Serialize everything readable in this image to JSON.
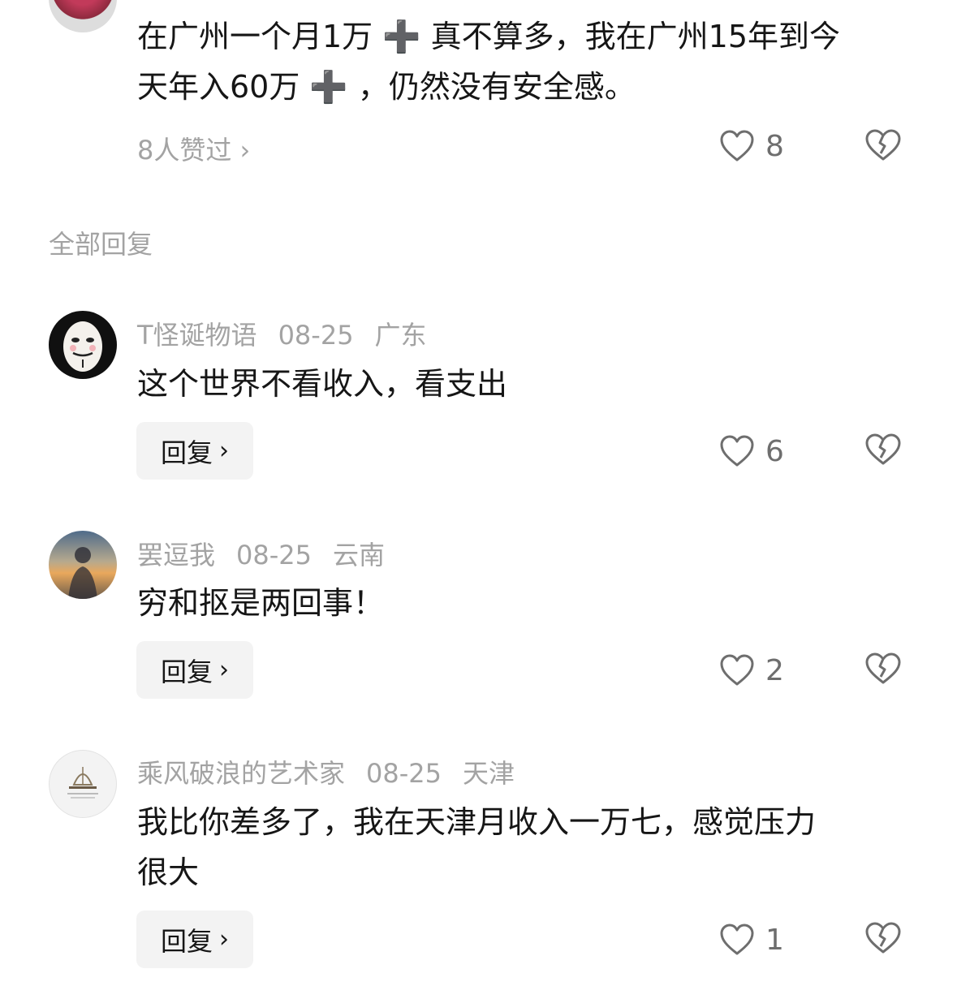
{
  "top_comment": {
    "text_line1": "在广州一个月1万 ➕ 真不算多，我在广州15年到今",
    "text_line2": "天年入60万 ➕ ，仍然没有安全感。",
    "liked_by": "8人赞过 ›",
    "likes": "8"
  },
  "section_title": "全部回复",
  "replies": [
    {
      "user": "T怪诞物语",
      "date": "08-25",
      "region": "广东",
      "text": "这个世界不看收入，看支出",
      "reply_label": "回复",
      "likes": "6"
    },
    {
      "user": "罢逗我",
      "date": "08-25",
      "region": "云南",
      "text": "穷和抠是两回事！",
      "reply_label": "回复",
      "likes": "2"
    },
    {
      "user": "乘风破浪的艺术家",
      "date": "08-25",
      "region": "天津",
      "text_line1": "我比你差多了，我在天津月收入一万七，感觉压力",
      "text_line2": "很大",
      "reply_label": "回复",
      "likes": "1"
    }
  ],
  "icons": {
    "like": "heart-outline-icon",
    "dislike": "broken-heart-icon",
    "chevron": "chevron-right-icon"
  },
  "colors": {
    "text": "#161616",
    "meta": "#a3a3a3",
    "button_bg": "#f3f3f3",
    "icon": "#6e6e6e"
  }
}
